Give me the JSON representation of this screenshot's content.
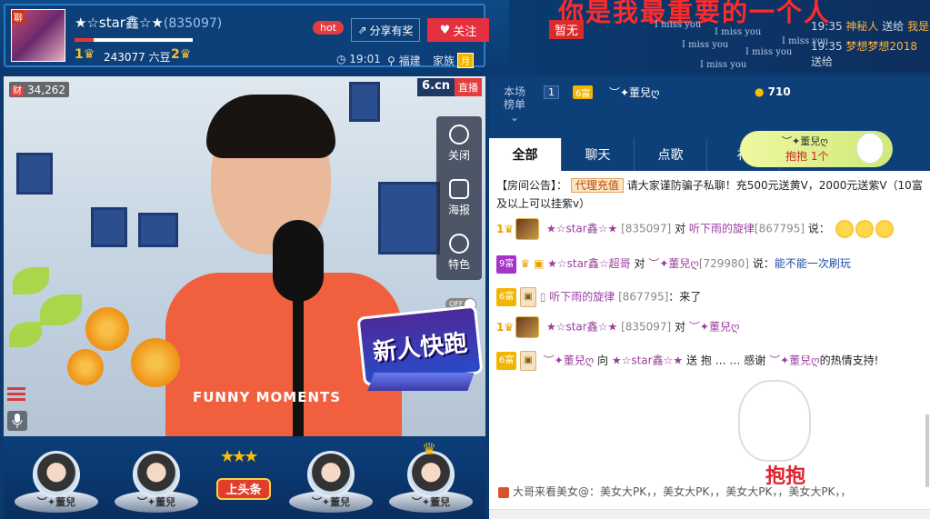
{
  "header": {
    "badge": "聊",
    "anchor_name": "★☆star鑫☆★",
    "anchor_id": "(835097)",
    "level_left": "1",
    "level_right": "2",
    "level_progress": 0.16,
    "beans": "243077 六豆",
    "hot_label": "hot",
    "share_label": "分享有奖",
    "follow_label": "关注",
    "time": "19:01",
    "location": "福建",
    "family_label": "家族",
    "family_badge": "月"
  },
  "banner": {
    "title": "你是我最重要的一个人",
    "tag": "暂无",
    "missyou": "I miss you",
    "ticker": [
      {
        "time": "19:35",
        "name": "神秘人",
        "text": "送给",
        "target": "我是"
      },
      {
        "time": "19:35",
        "name": "梦想梦想2018",
        "text": "送给",
        "target": ""
      }
    ]
  },
  "video": {
    "viewer_badge": "财",
    "viewer_count": "34,262",
    "logo": "6.cn",
    "live_label": "直播",
    "tools": [
      {
        "label": "关闭",
        "icon": "power-icon"
      },
      {
        "label": "海报",
        "icon": "poster-icon"
      },
      {
        "label": "特色",
        "icon": "feature-icon"
      }
    ],
    "toggle_label": "OFF",
    "shirt_text": "FUNNY MOMENTS",
    "promo": "新人快跑"
  },
  "seats": [
    {
      "name": "︶✦董兒"
    },
    {
      "name": "︶✦董兒"
    },
    {
      "name": "︶✦董兒"
    },
    {
      "name": "︶✦董兒"
    }
  ],
  "toutiao_label": "上头条",
  "rank": {
    "title": "本场榜单",
    "num": "1",
    "badge": "6富",
    "name": "︶✦董兒ღ",
    "coin": "710"
  },
  "tabs": [
    "全部",
    "聊天",
    "点歌",
    "礼"
  ],
  "hug": {
    "name": "︶✦董兒ღ",
    "text": "抱抱",
    "count": "1个"
  },
  "chat": {
    "notice_prefix": "【房间公告】：",
    "notice_button": "代理充值",
    "notice_text": "请大家谨防骗子私聊！充500元送黄V，2000元送紫V（10富及以上可以挂紫v）",
    "m1_user": "★☆star鑫☆★",
    "m1_uid": "[835097]",
    "m1_to": "对",
    "m1_target": "听下雨的旋律",
    "m1_tuid": "[867795]",
    "m1_said": "说：",
    "m2_badge": "9富",
    "m2_user": "★☆star鑫☆超哥",
    "m2_to": "对",
    "m2_target": "︶✦董兒ღ",
    "m2_tuid": "[729980]",
    "m2_said": "说：",
    "m2_text": "能不能一次刷玩",
    "m3_badge": "6富",
    "m3_user": "听下雨的旋律",
    "m3_uid": "[867795]",
    "m3_text": "：来了",
    "m4_user": "★☆star鑫☆★",
    "m4_uid": "[835097]",
    "m4_to": "对",
    "m4_target": "︶✦董兒ღ",
    "m5_badge": "6富",
    "m5_user": "︶✦董兒ღ",
    "m5_to": "向",
    "m5_target": "★☆star鑫☆★",
    "m5_send": "送",
    "m5_gift": "抱",
    "m5_thanks": "感谢",
    "m5_thanks_user": "︶✦董兒ღ",
    "m5_tail": "的热情支持!",
    "lvl1": "1",
    "big_cat_text": "抱抱"
  },
  "bottom_note": "大哥来看美女@：美女大PK，，美女大PK，，美女大PK，，美女大PK，，"
}
